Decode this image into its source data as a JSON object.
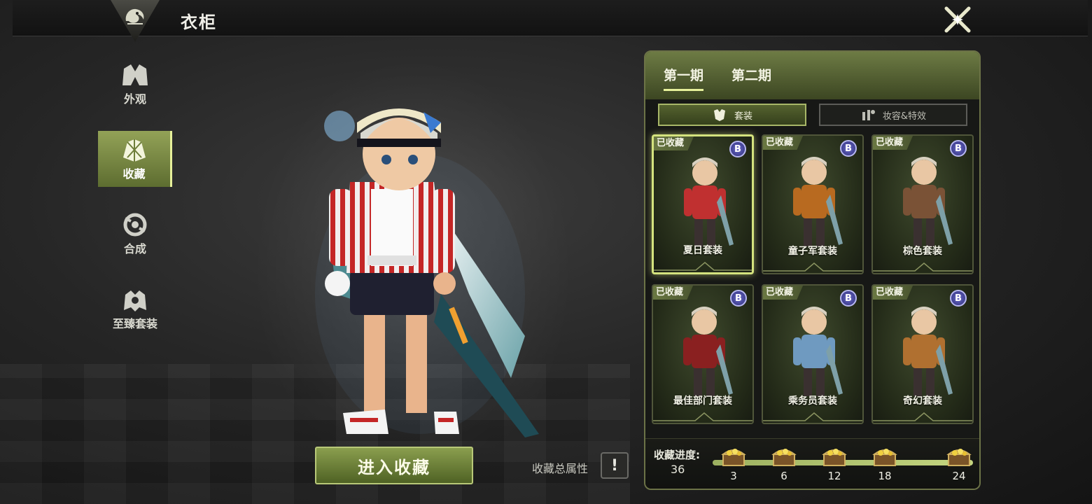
{
  "window": {
    "title": "衣柜"
  },
  "sidebar": {
    "items": [
      {
        "label": "外观",
        "icon": "appearance-icon",
        "active": false
      },
      {
        "label": "收藏",
        "icon": "collection-icon",
        "active": true
      },
      {
        "label": "合成",
        "icon": "synthesis-icon",
        "active": false
      },
      {
        "label": "至臻套装",
        "icon": "supreme-set-icon",
        "active": false
      }
    ]
  },
  "main": {
    "enter_button": "进入收藏",
    "total_attr_label": "收藏总属性",
    "info_icon": "!"
  },
  "panel": {
    "periods": [
      {
        "label": "第一期",
        "active": true
      },
      {
        "label": "第二期",
        "active": false
      }
    ],
    "subtabs": [
      {
        "label": "套装",
        "icon": "outfit-icon",
        "active": true
      },
      {
        "label": "妆容&特效",
        "icon": "makeup-icon",
        "active": false
      }
    ],
    "cards": [
      {
        "badge": "已收藏",
        "grade": "B",
        "name": "夏日套装",
        "selected": true,
        "color": "#c03030"
      },
      {
        "badge": "已收藏",
        "grade": "B",
        "name": "童子军套装",
        "selected": false,
        "color": "#b86a20"
      },
      {
        "badge": "已收藏",
        "grade": "B",
        "name": "棕色套装",
        "selected": false,
        "color": "#7a5236"
      },
      {
        "badge": "已收藏",
        "grade": "B",
        "name": "最佳部门套装",
        "selected": false,
        "color": "#8a2020"
      },
      {
        "badge": "已收藏",
        "grade": "B",
        "name": "乘务员套装",
        "selected": false,
        "color": "#6f9ac0"
      },
      {
        "badge": "已收藏",
        "grade": "B",
        "name": "奇幻套装",
        "selected": false,
        "color": "#b07030"
      }
    ],
    "progress": {
      "label": "收藏进度:",
      "value": "36",
      "fill_fraction": 1.0,
      "milestones": [
        "3",
        "6",
        "12",
        "18",
        "24"
      ]
    }
  },
  "colors": {
    "accent": "#93a257",
    "accent_light": "#e6f09a",
    "grade_badge": "#4a4aa8"
  }
}
